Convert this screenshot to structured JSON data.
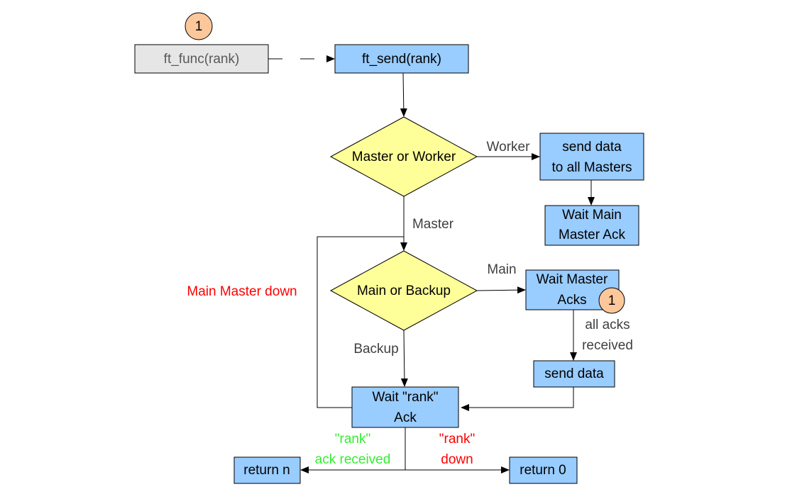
{
  "colors": {
    "process": "#99ccff",
    "decision": "#ffff99",
    "external": "#e6e6e6",
    "marker": "#fcc89b",
    "error": "#ff0000",
    "success": "#33ee33"
  },
  "nodes": {
    "marker_top": "1",
    "ft_func": "ft_func(rank)",
    "ft_send": "ft_send(rank)",
    "master_or_worker": "Master or Worker",
    "send_data_masters": [
      "send data",
      "to all Masters"
    ],
    "wait_main_master_ack": [
      "Wait Main",
      "Master Ack"
    ],
    "main_or_backup": "Main or Backup",
    "wait_master_acks": [
      "Wait Master",
      "Acks"
    ],
    "marker_acks": "1",
    "send_data": "send data",
    "wait_rank_ack": [
      "Wait \"rank\"",
      "Ack"
    ],
    "return_n": "return n",
    "return_0": "return 0"
  },
  "edges": {
    "worker": "Worker",
    "master": "Master",
    "main": "Main",
    "backup": "Backup",
    "all_acks": [
      "all acks",
      "received"
    ],
    "main_master_down": "Main Master down",
    "rank_ack_received": [
      "\"rank\"",
      "ack received"
    ],
    "rank_down": [
      "\"rank\"",
      "down"
    ]
  }
}
